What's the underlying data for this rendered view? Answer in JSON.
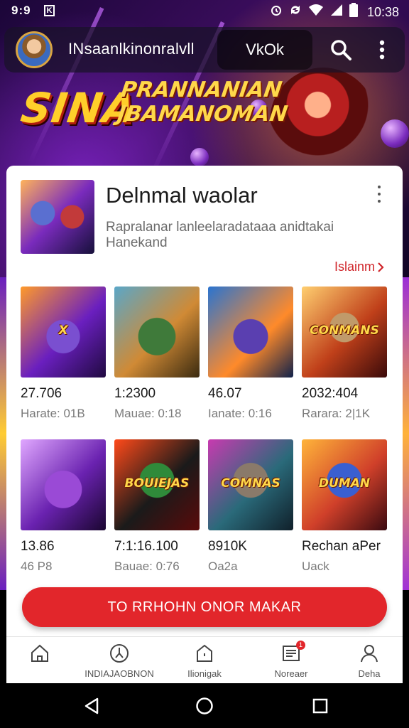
{
  "status_bar": {
    "time": "9:9",
    "app_badge": "K",
    "clock": "10:38"
  },
  "app_bar": {
    "channel_name": "INsaanlkinonralvll",
    "vk_button_label": "VkOk"
  },
  "hero": {
    "title_big": "SINA",
    "title_line1": "PRANNANIAN",
    "title_line2": "JBAMANOMAN"
  },
  "featured": {
    "title": "Delnmal waolar",
    "description": "Rapralanar lanleelaradataaa anidtakai Hanekand",
    "see_more": "Islainm"
  },
  "tiles": [
    {
      "thumb_label": "X",
      "main": "27.706",
      "sub": "Harate: 01B"
    },
    {
      "thumb_label": "",
      "main": "1:2300",
      "sub": "Mauae: 0:18"
    },
    {
      "thumb_label": "",
      "main": "46.07",
      "sub": "Ianate: 0:16"
    },
    {
      "thumb_label": "CONMANS",
      "main": "2032:404",
      "sub": "Rarara: 2|1K"
    },
    {
      "thumb_label": "",
      "main": "13.86",
      "sub": "46 P8"
    },
    {
      "thumb_label": "BOUIEJAS",
      "main": "7:1:16.100",
      "sub": "Bauae: 0:76"
    },
    {
      "thumb_label": "COMNAS",
      "main": "8910K",
      "sub": "Oa2a"
    },
    {
      "thumb_label": "DUMAN",
      "main": "Rechan aPer",
      "sub": "Uack"
    }
  ],
  "cta": {
    "label": "TO RRHOHN ONOR MAKAR"
  },
  "bottom_nav": [
    {
      "label": "",
      "icon": "home-icon"
    },
    {
      "label": "INDIAJAOBNON",
      "icon": "compass-icon"
    },
    {
      "label": "Ilionigak",
      "icon": "store-icon"
    },
    {
      "label": "Noreaer",
      "icon": "inbox-icon",
      "badge": "1"
    },
    {
      "label": "Deha",
      "icon": "profile-icon"
    }
  ]
}
